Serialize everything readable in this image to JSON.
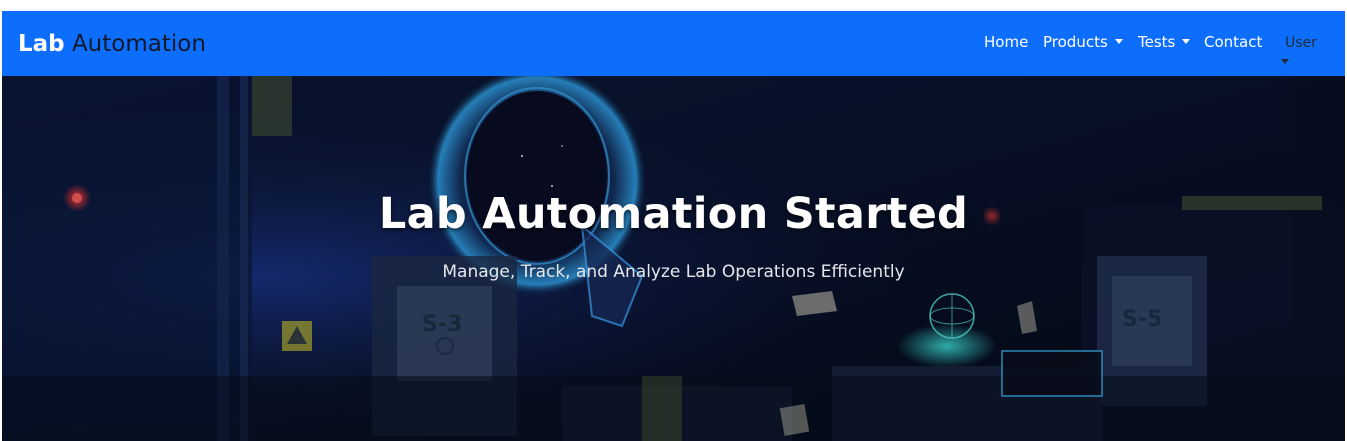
{
  "navbar": {
    "brand_part1": "Lab",
    "brand_part2": "Automation",
    "items": [
      {
        "label": "Home"
      },
      {
        "label": "Products"
      },
      {
        "label": "Tests"
      },
      {
        "label": "Contact"
      }
    ],
    "user_label": "User",
    "background_color": "#0d6efd"
  },
  "hero": {
    "title": "Lab Automation Started",
    "subtitle": "Manage, Track, and Analyze Lab Operations Efficiently"
  }
}
